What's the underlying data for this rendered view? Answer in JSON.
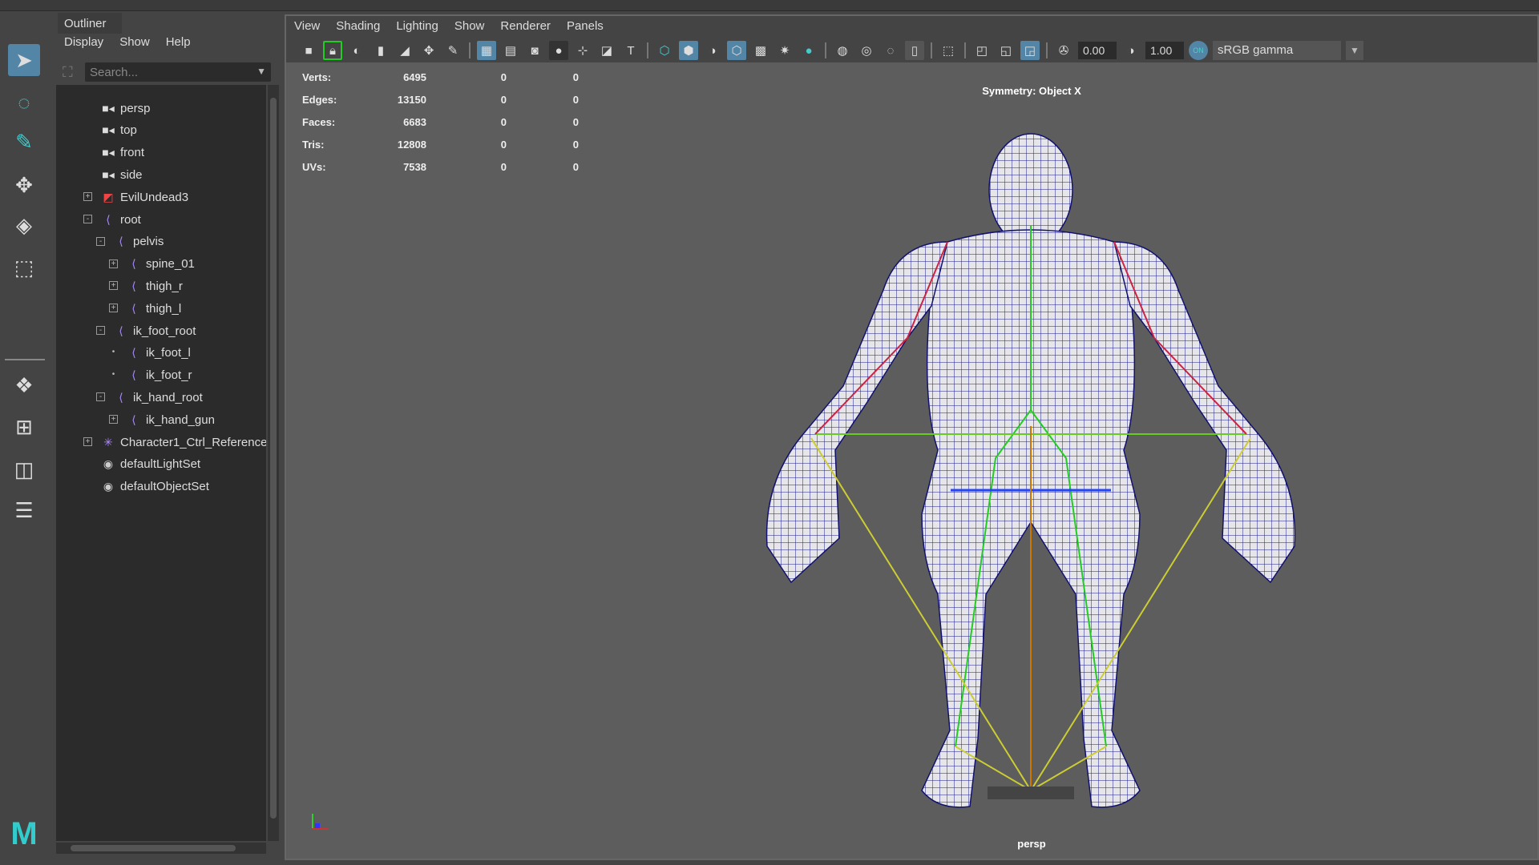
{
  "outliner": {
    "tab": "Outliner",
    "menu": [
      "Display",
      "Show",
      "Help"
    ],
    "search_placeholder": "Search...",
    "items": [
      {
        "label": "persp",
        "icon": "camera-icon",
        "depth": 0,
        "expander": ""
      },
      {
        "label": "top",
        "icon": "camera-icon",
        "depth": 0,
        "expander": ""
      },
      {
        "label": "front",
        "icon": "camera-icon",
        "depth": 0,
        "expander": ""
      },
      {
        "label": "side",
        "icon": "camera-icon",
        "depth": 0,
        "expander": ""
      },
      {
        "label": "EvilUndead3",
        "icon": "mesh-icon",
        "depth": 0,
        "expander": "+"
      },
      {
        "label": "root",
        "icon": "joint-icon",
        "depth": 0,
        "expander": "-"
      },
      {
        "label": "pelvis",
        "icon": "joint-icon",
        "depth": 1,
        "expander": "-"
      },
      {
        "label": "spine_01",
        "icon": "joint-icon",
        "depth": 2,
        "expander": "+"
      },
      {
        "label": "thigh_r",
        "icon": "joint-icon",
        "depth": 2,
        "expander": "+"
      },
      {
        "label": "thigh_l",
        "icon": "joint-icon",
        "depth": 2,
        "expander": "+"
      },
      {
        "label": "ik_foot_root",
        "icon": "joint-icon",
        "depth": 1,
        "expander": "-"
      },
      {
        "label": "ik_foot_l",
        "icon": "joint-icon",
        "depth": 2,
        "expander": "•"
      },
      {
        "label": "ik_foot_r",
        "icon": "joint-icon",
        "depth": 2,
        "expander": "•"
      },
      {
        "label": "ik_hand_root",
        "icon": "joint-icon",
        "depth": 1,
        "expander": "-"
      },
      {
        "label": "ik_hand_gun",
        "icon": "joint-icon",
        "depth": 2,
        "expander": "+"
      },
      {
        "label": "Character1_Ctrl_Reference",
        "icon": "hik-icon",
        "depth": 0,
        "expander": "+"
      },
      {
        "label": "defaultLightSet",
        "icon": "set-icon",
        "depth": 0,
        "expander": ""
      },
      {
        "label": "defaultObjectSet",
        "icon": "set-icon",
        "depth": 0,
        "expander": ""
      }
    ]
  },
  "viewport": {
    "menu": [
      "View",
      "Shading",
      "Lighting",
      "Show",
      "Renderer",
      "Panels"
    ],
    "exposure": "0.00",
    "gamma_value": "1.00",
    "color_space": "sRGB gamma",
    "on_label": "ON",
    "stats": [
      [
        "Verts:",
        "6495",
        "0",
        "0"
      ],
      [
        "Edges:",
        "13150",
        "0",
        "0"
      ],
      [
        "Faces:",
        "6683",
        "0",
        "0"
      ],
      [
        "Tris:",
        "12808",
        "0",
        "0"
      ],
      [
        "UVs:",
        "7538",
        "0",
        "0"
      ]
    ],
    "symmetry": "Symmetry: Object X",
    "camera": "persp"
  },
  "colors": {
    "accent": "#5285a6",
    "wire": "#1a1a8c"
  }
}
